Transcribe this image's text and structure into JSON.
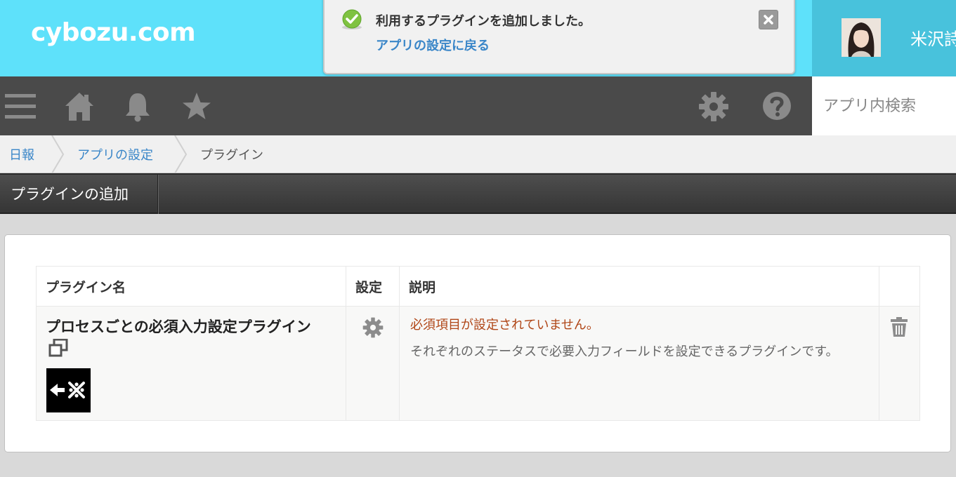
{
  "header": {
    "logo": "cybozu.com",
    "user_name": "米沢詩"
  },
  "notification": {
    "message": "利用するプラグインを追加しました。",
    "link": "アプリの設定に戻る",
    "status_color": "#7fc241"
  },
  "toolbar": {
    "icons": [
      "menu-icon",
      "home-icon",
      "bell-icon",
      "star-icon",
      "gear-icon",
      "help-icon"
    ],
    "search_placeholder": "アプリ内検索"
  },
  "breadcrumb": {
    "items": [
      "日報",
      "アプリの設定",
      "プラグイン"
    ]
  },
  "section": {
    "title": "プラグインの追加"
  },
  "table": {
    "headers": {
      "name": "プラグイン名",
      "settings": "設定",
      "description": "説明"
    },
    "rows": [
      {
        "name": "プロセスごとの必須入力設定プラグイン",
        "error": "必須項目が設定されていません。",
        "description": "それぞれのステータスで必要入力フィールドを設定できるプラグインです。"
      }
    ]
  },
  "colors": {
    "header_bg": "#5ee1fa",
    "toolbar_bg": "#4a4a4a",
    "link": "#3a86c8",
    "error": "#b04617"
  }
}
